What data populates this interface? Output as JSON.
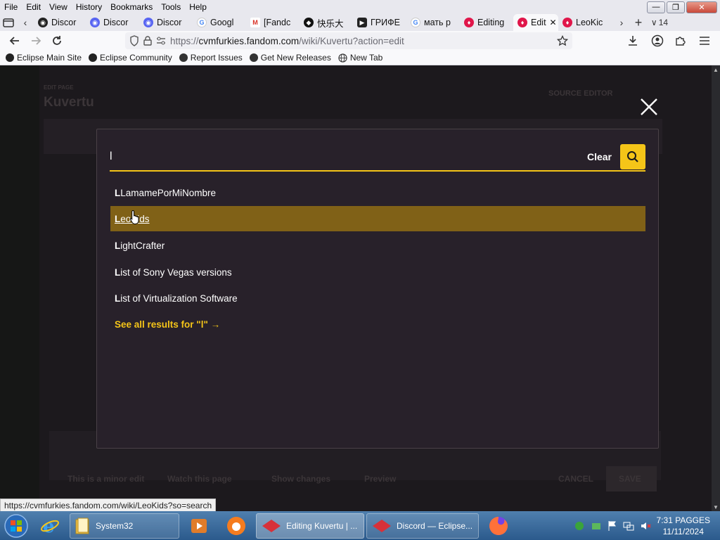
{
  "menubar": {
    "items": [
      "File",
      "Edit",
      "View",
      "History",
      "Bookmarks",
      "Tools",
      "Help"
    ]
  },
  "tabs": [
    {
      "label": "Discor",
      "icon": "discord-icon"
    },
    {
      "label": "Discor",
      "icon": "discord-icon"
    },
    {
      "label": "Discor",
      "icon": "discord-icon"
    },
    {
      "label": "Googl",
      "icon": "google-icon"
    },
    {
      "label": "[Fandc",
      "icon": "gmail-icon"
    },
    {
      "label": "快乐大",
      "icon": "github-icon"
    },
    {
      "label": "ГРИФЕ",
      "icon": "youtube-icon"
    },
    {
      "label": "мать р",
      "icon": "google-icon"
    },
    {
      "label": "Editing",
      "icon": "fandom-icon"
    },
    {
      "label": "Edit",
      "icon": "fandom-icon",
      "active": true
    },
    {
      "label": "LeoKic",
      "icon": "fandom-icon"
    }
  ],
  "tab_count": "14",
  "address": {
    "url_prefix": "https://",
    "url_domain": "cvmfurkies.fandom.com",
    "url_path": "/wiki/Kuvertu?action=edit"
  },
  "bookmarks": [
    {
      "label": "Eclipse Main Site",
      "icon": "eclipse-icon"
    },
    {
      "label": "Eclipse Community",
      "icon": "eclipse-icon"
    },
    {
      "label": "Report Issues",
      "icon": "github-icon"
    },
    {
      "label": "Get New Releases",
      "icon": "github-icon"
    },
    {
      "label": "New Tab",
      "icon": "globe-icon"
    }
  ],
  "editor_bg": {
    "eyebrow": "EDIT PAGE",
    "page_title": "Kuvertu",
    "source_editor": "SOURCE EDITOR",
    "minor_edit": "This is a minor edit",
    "watch": "Watch this page",
    "show_changes": "Show changes",
    "preview": "Preview",
    "cancel": "CANCEL",
    "save": "SAVE"
  },
  "search": {
    "query": "l",
    "clear_label": "Clear",
    "results": [
      {
        "highlight": "L",
        "rest": "LamamePorMiNombre"
      },
      {
        "highlight": "L",
        "rest": "eoKids",
        "active": true
      },
      {
        "highlight": "L",
        "rest": "ightCrafter"
      },
      {
        "highlight": "L",
        "rest": "ist of Sony Vegas versions"
      },
      {
        "highlight": "L",
        "rest": "ist of Virtualization Software"
      }
    ],
    "see_all": "See all results for \"l\" →"
  },
  "status_url": "https://cvmfurkies.fandom.com/wiki/LeoKids?so=search",
  "taskbar": {
    "items": [
      {
        "label": "System32",
        "icon": "folder-icon"
      },
      {
        "label": "Editing Kuvertu | ...",
        "icon": "fandom-icon",
        "active": true
      },
      {
        "label": "Discord — Eclipse...",
        "icon": "fandom-icon"
      }
    ],
    "clock_time": "7:31 PAGGES",
    "clock_date": "11/11/2024"
  },
  "colors": {
    "accent": "#f5c518",
    "active_result": "#806117",
    "modal_bg": "#28212a"
  }
}
